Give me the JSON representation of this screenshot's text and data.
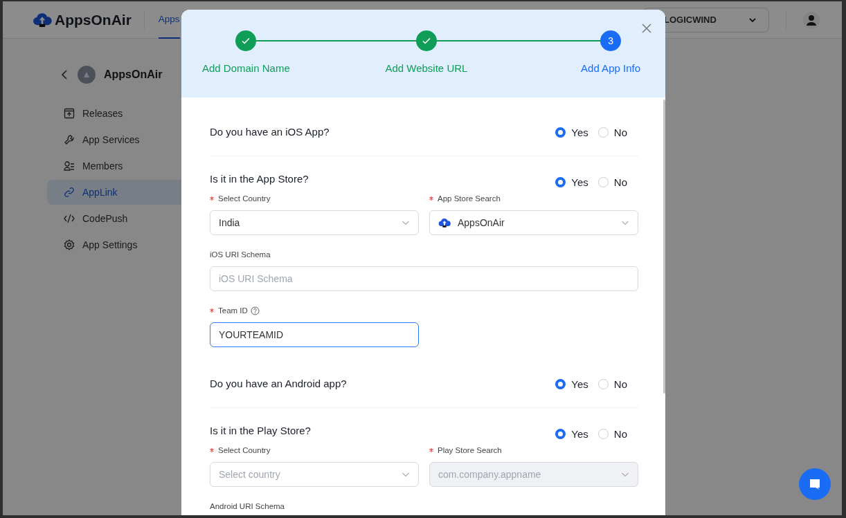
{
  "header": {
    "logo": "AppsOnAir",
    "nav_tabs": [
      {
        "label": "Apps",
        "selected": true
      }
    ],
    "org_select": {
      "value": "LOGICWIND"
    }
  },
  "sidebar": {
    "app_name": "AppsOnAir",
    "items": [
      {
        "label": "Releases",
        "selected": false
      },
      {
        "label": "App Services",
        "selected": false
      },
      {
        "label": "Members",
        "selected": false
      },
      {
        "label": "AppLink",
        "selected": true
      },
      {
        "label": "CodePush",
        "selected": false
      },
      {
        "label": "App Settings",
        "selected": false
      }
    ]
  },
  "modal": {
    "steps": [
      {
        "label": "Add Domain Name",
        "completed": true
      },
      {
        "label": "Add Website URL",
        "completed": true
      },
      {
        "label": "Add App Info",
        "completed": false,
        "number": "3"
      }
    ],
    "blocks": [
      {
        "kind": "question",
        "text": "Do you have an iOS App?",
        "divider": true,
        "options": [
          {
            "label": "Yes",
            "selected": true
          },
          {
            "label": "No",
            "selected": false
          }
        ]
      },
      {
        "kind": "question",
        "text": "Is it in the App Store?",
        "divider": false,
        "options": [
          {
            "label": "Yes",
            "selected": true
          },
          {
            "label": "No",
            "selected": false
          }
        ]
      },
      {
        "kind": "fields",
        "rows": [
          [
            {
              "label": "Select Country",
              "required": true,
              "kind": "select",
              "value": "India"
            },
            {
              "label": "App Store Search",
              "required": true,
              "kind": "app_select",
              "value": "AppsOnAir"
            }
          ],
          [
            {
              "label": "iOS URI Schema",
              "required": false,
              "kind": "text",
              "placeholder": "iOS URI Schema",
              "focused": false
            }
          ],
          [
            {
              "label": "Team ID",
              "required": true,
              "help": true,
              "kind": "text",
              "value": "YOURTEAMID",
              "focused": true
            }
          ]
        ]
      },
      {
        "kind": "question",
        "text": "Do you have an Android app?",
        "divider": true,
        "options": [
          {
            "label": "Yes",
            "selected": true
          },
          {
            "label": "No",
            "selected": false
          }
        ]
      },
      {
        "kind": "question",
        "text": "Is it in the Play Store?",
        "divider": false,
        "options": [
          {
            "label": "Yes",
            "selected": true
          },
          {
            "label": "No",
            "selected": false
          }
        ]
      },
      {
        "kind": "fields",
        "rows": [
          [
            {
              "label": "Select Country",
              "required": true,
              "kind": "select",
              "placeholder": "Select country"
            },
            {
              "label": "Play Store Search",
              "required": true,
              "kind": "select",
              "placeholder": "com.company.appname",
              "disabled": true
            }
          ],
          [
            {
              "label": "Android URI Schema",
              "required": false,
              "kind": "label"
            }
          ]
        ]
      }
    ]
  }
}
